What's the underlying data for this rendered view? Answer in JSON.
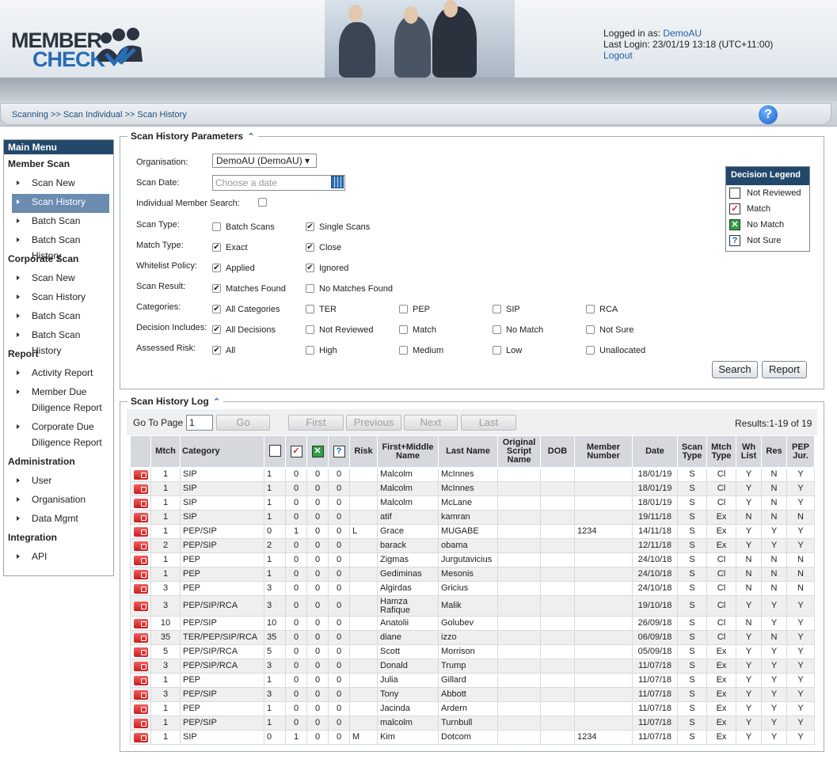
{
  "header": {
    "logo_line1": "MEMBER",
    "logo_line2": "CHECK",
    "logged_in_label": "Logged in as: ",
    "user": "DemoAU",
    "last_login": "Last Login: 23/01/19 13:18 (UTC+11:00)",
    "logout": "Logout"
  },
  "breadcrumb": "Scanning >> Scan Individual >> Scan History",
  "sidebar": {
    "title": "Main Menu",
    "sections": [
      {
        "title": "Member Scan",
        "items": [
          "Scan New",
          "Scan History",
          "Batch Scan",
          "Batch Scan History"
        ]
      },
      {
        "title": "Corporate Scan",
        "items": [
          "Scan New",
          "Scan History",
          "Batch Scan",
          "Batch Scan History"
        ]
      },
      {
        "title": "Report",
        "items": [
          "Activity Report",
          "Member Due Diligence Report",
          "Corporate Due Diligence Report"
        ]
      },
      {
        "title": "Administration",
        "items": [
          "User",
          "Organisation",
          "Data Mgmt"
        ]
      },
      {
        "title": "Integration",
        "items": [
          "API"
        ]
      }
    ],
    "active": "Member Scan / Scan History"
  },
  "params": {
    "title": "Scan History Parameters",
    "organisation_label": "Organisation:",
    "organisation_value": "DemoAU (DemoAU)",
    "scan_date_label": "Scan Date:",
    "scan_date_placeholder": "Choose a date",
    "individual_label": "Individual Member Search:",
    "scan_type_label": "Scan Type:",
    "scan_type": [
      {
        "label": "Batch Scans",
        "checked": false
      },
      {
        "label": "Single Scans",
        "checked": true
      }
    ],
    "match_type_label": "Match Type:",
    "match_type": [
      {
        "label": "Exact",
        "checked": true
      },
      {
        "label": "Close",
        "checked": true
      }
    ],
    "whitelist_label": "Whitelist Policy:",
    "whitelist": [
      {
        "label": "Applied",
        "checked": true
      },
      {
        "label": "Ignored",
        "checked": true
      }
    ],
    "scan_result_label": "Scan Result:",
    "scan_result": [
      {
        "label": "Matches Found",
        "checked": true
      },
      {
        "label": "No Matches Found",
        "checked": false
      }
    ],
    "categories_label": "Categories:",
    "categories": [
      {
        "label": "All Categories",
        "checked": true
      },
      {
        "label": "TER",
        "checked": false
      },
      {
        "label": "PEP",
        "checked": false
      },
      {
        "label": "SIP",
        "checked": false
      },
      {
        "label": "RCA",
        "checked": false
      }
    ],
    "decision_label": "Decision Includes:",
    "decision": [
      {
        "label": "All Decisions",
        "checked": true
      },
      {
        "label": "Not Reviewed",
        "checked": false
      },
      {
        "label": "Match",
        "checked": false
      },
      {
        "label": "No Match",
        "checked": false
      },
      {
        "label": "Not Sure",
        "checked": false
      }
    ],
    "risk_label": "Assessed Risk:",
    "risk": [
      {
        "label": "All",
        "checked": true
      },
      {
        "label": "High",
        "checked": false
      },
      {
        "label": "Medium",
        "checked": false
      },
      {
        "label": "Low",
        "checked": false
      },
      {
        "label": "Unallocated",
        "checked": false
      }
    ],
    "search_button": "Search",
    "report_button": "Report"
  },
  "decision_legend": {
    "title": "Decision Legend",
    "items": [
      "Not Reviewed",
      "Match",
      "No Match",
      "Not Sure"
    ]
  },
  "log": {
    "title": "Scan History Log",
    "goto_label": "Go To Page",
    "goto_value": "1",
    "go": "Go",
    "first": "First",
    "previous": "Previous",
    "next": "Next",
    "last": "Last",
    "results": "Results:1-19 of 19",
    "columns": [
      "",
      "Mtch",
      "Category",
      "",
      "",
      "",
      "",
      "Risk",
      "First+Middle Name",
      "Last Name",
      "Original Script Name",
      "DOB",
      "Member Number",
      "Date",
      "Scan Type",
      "Mtch Type",
      "Wh List",
      "Res",
      "PEP Jur."
    ],
    "rows": [
      [
        "1",
        "SIP",
        "1",
        "0",
        "0",
        "0",
        "",
        "Malcolm",
        "McInnes",
        "",
        "",
        "",
        "18/01/19",
        "S",
        "Cl",
        "Y",
        "N",
        "Y"
      ],
      [
        "1",
        "SIP",
        "1",
        "0",
        "0",
        "0",
        "",
        "Malcolm",
        "McInnes",
        "",
        "",
        "",
        "18/01/19",
        "S",
        "Cl",
        "Y",
        "N",
        "Y"
      ],
      [
        "1",
        "SIP",
        "1",
        "0",
        "0",
        "0",
        "",
        "Malcolm",
        "McLane",
        "",
        "",
        "",
        "18/01/19",
        "S",
        "Cl",
        "Y",
        "N",
        "Y"
      ],
      [
        "1",
        "SIP",
        "1",
        "0",
        "0",
        "0",
        "",
        "atif",
        "kamran",
        "",
        "",
        "",
        "19/11/18",
        "S",
        "Ex",
        "N",
        "N",
        "N"
      ],
      [
        "1",
        "PEP/SIP",
        "0",
        "1",
        "0",
        "0",
        "L",
        "Grace",
        "MUGABE",
        "",
        "",
        "1234",
        "14/11/18",
        "S",
        "Ex",
        "Y",
        "Y",
        "Y"
      ],
      [
        "2",
        "PEP/SIP",
        "2",
        "0",
        "0",
        "0",
        "",
        "barack",
        "obama",
        "",
        "",
        "",
        "12/11/18",
        "S",
        "Ex",
        "Y",
        "Y",
        "Y"
      ],
      [
        "1",
        "PEP",
        "1",
        "0",
        "0",
        "0",
        "",
        "Zigmas",
        "Jurgutavicius",
        "",
        "",
        "",
        "24/10/18",
        "S",
        "Cl",
        "N",
        "N",
        "N"
      ],
      [
        "1",
        "PEP",
        "1",
        "0",
        "0",
        "0",
        "",
        "Gediminas",
        "Mesonis",
        "",
        "",
        "",
        "24/10/18",
        "S",
        "Cl",
        "N",
        "N",
        "N"
      ],
      [
        "3",
        "PEP",
        "3",
        "0",
        "0",
        "0",
        "",
        "Algirdas",
        "Gricius",
        "",
        "",
        "",
        "24/10/18",
        "S",
        "Cl",
        "N",
        "N",
        "N"
      ],
      [
        "3",
        "PEP/SIP/RCA",
        "3",
        "0",
        "0",
        "0",
        "",
        "Hamza Rafique",
        "Malik",
        "",
        "",
        "",
        "19/10/18",
        "S",
        "Cl",
        "Y",
        "Y",
        "Y"
      ],
      [
        "10",
        "PEP/SIP",
        "10",
        "0",
        "0",
        "0",
        "",
        "Anatolii",
        "Golubev",
        "",
        "",
        "",
        "26/09/18",
        "S",
        "Cl",
        "N",
        "Y",
        "Y"
      ],
      [
        "35",
        "TER/PEP/SIP/RCA",
        "35",
        "0",
        "0",
        "0",
        "",
        "diane",
        "izzo",
        "",
        "",
        "",
        "06/09/18",
        "S",
        "Cl",
        "Y",
        "N",
        "Y"
      ],
      [
        "5",
        "PEP/SIP/RCA",
        "5",
        "0",
        "0",
        "0",
        "",
        "Scott",
        "Morrison",
        "",
        "",
        "",
        "05/09/18",
        "S",
        "Ex",
        "Y",
        "Y",
        "Y"
      ],
      [
        "3",
        "PEP/SIP/RCA",
        "3",
        "0",
        "0",
        "0",
        "",
        "Donald",
        "Trump",
        "",
        "",
        "",
        "11/07/18",
        "S",
        "Ex",
        "Y",
        "Y",
        "Y"
      ],
      [
        "1",
        "PEP",
        "1",
        "0",
        "0",
        "0",
        "",
        "Julia",
        "Gillard",
        "",
        "",
        "",
        "11/07/18",
        "S",
        "Ex",
        "Y",
        "Y",
        "Y"
      ],
      [
        "3",
        "PEP/SIP",
        "3",
        "0",
        "0",
        "0",
        "",
        "Tony",
        "Abbott",
        "",
        "",
        "",
        "11/07/18",
        "S",
        "Ex",
        "Y",
        "Y",
        "Y"
      ],
      [
        "1",
        "PEP",
        "1",
        "0",
        "0",
        "0",
        "",
        "Jacinda",
        "Ardern",
        "",
        "",
        "",
        "11/07/18",
        "S",
        "Ex",
        "Y",
        "Y",
        "Y"
      ],
      [
        "1",
        "PEP/SIP",
        "1",
        "0",
        "0",
        "0",
        "",
        "malcolm",
        "Turnbull",
        "",
        "",
        "",
        "11/07/18",
        "S",
        "Ex",
        "Y",
        "Y",
        "Y"
      ],
      [
        "1",
        "SIP",
        "0",
        "1",
        "0",
        "0",
        "M",
        "Kim",
        "Dotcom",
        "",
        "",
        "1234",
        "11/07/18",
        "S",
        "Ex",
        "Y",
        "Y",
        "Y"
      ]
    ]
  }
}
